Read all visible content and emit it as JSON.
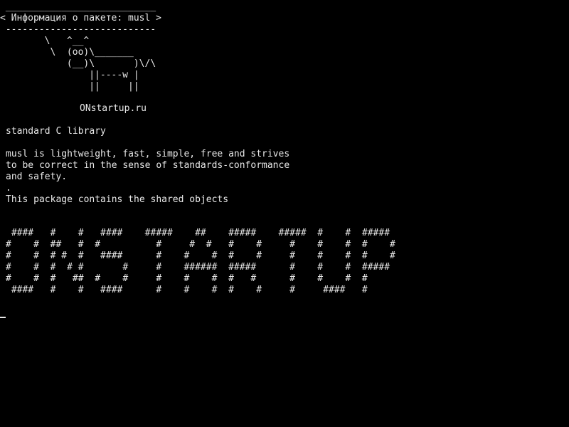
{
  "cowsay": {
    "lines": [
      " ___________________________",
      "< Информация о пакете: musl >",
      " ---------------------------",
      "        \\   ^__^",
      "         \\  (oo)\\_______",
      "            (__)\\       )\\/\\",
      "                ||----w |",
      "                ||     ||"
    ]
  },
  "site": "ONstartup.ru",
  "package": {
    "lines": [
      "standard C library",
      "",
      "musl is lightweight, fast, simple, free and strives",
      "to be correct in the sense of standards-conformance",
      "and safety.",
      ".",
      "This package contains the shared objects"
    ]
  },
  "banner": {
    "lines": [
      " ####   #    #   ####    #####    ##    #####    #####  #    #  #####",
      "#    #  ##   #  #          #     #  #   #    #     #    #    #  #    #",
      "#    #  # #  #   ####      #    #    #  #    #     #    #    #  #    #",
      "#    #  #  # #       #     #    ######  #####      #    #    #  #####",
      "#    #  #   ##  #    #     #    #    #  #   #      #    #    #  #",
      " ####   #    #   ####      #    #    #  #    #     #     ####   #"
    ]
  },
  "colors": {
    "background": "#000000",
    "foreground": "#e8e8e8"
  }
}
